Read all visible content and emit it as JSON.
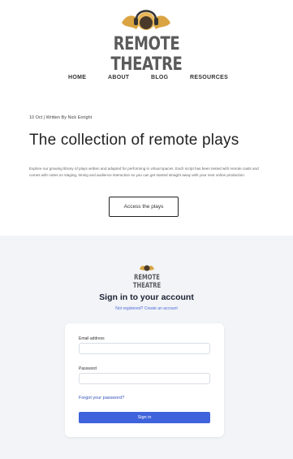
{
  "header": {
    "brand": "REMOTE THEATRE",
    "logo_icon": "headphones-mask-icon"
  },
  "nav": {
    "items": [
      "HOME",
      "ABOUT",
      "BLOG",
      "RESOURCES"
    ]
  },
  "article": {
    "meta": "10 Oct  |  Written By Nick Enright",
    "title": "The collection of remote plays",
    "excerpt": "Explore our growing library of plays written and adapted for performing in virtual spaces. Each script has been tested with remote casts and comes with notes on staging, timing and audience interaction so you can get started straight away with your next online production.",
    "cta_label": "Access the plays"
  },
  "signin": {
    "brand": "REMOTE THEATRE",
    "title": "Sign in to your account",
    "subtitle": "Not registered? Create an account",
    "email_label": "Email address",
    "email_value": "",
    "password_label": "Password",
    "password_value": "",
    "forgot_label": "Forgot your password?",
    "submit_label": "Sign in"
  },
  "colors": {
    "accent": "#3f63dc",
    "link": "#3450b5",
    "brand_gray": "#5b5b5b",
    "logo_gold": "#d9a441",
    "panel_bg": "#f2f4f8"
  }
}
